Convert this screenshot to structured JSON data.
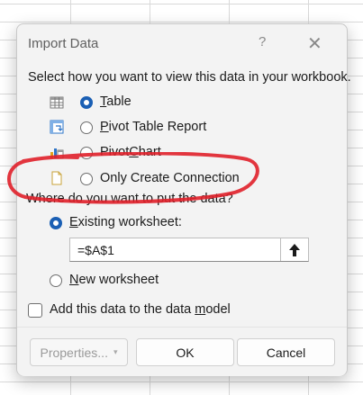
{
  "dialog": {
    "title": "Import Data",
    "help_glyph": "?",
    "close_glyph": "✕"
  },
  "view_section": {
    "prompt": "Select how you want to view this data in your workbook.",
    "options": [
      {
        "label_first": "T",
        "label_rest": "able",
        "selected": true,
        "icon": "table-icon"
      },
      {
        "label_first": "P",
        "label_rest": "ivot Table Report",
        "selected": false,
        "icon": "pivot-table-icon"
      },
      {
        "label_before": "Pivot",
        "label_u": "C",
        "label_rest": "hart",
        "selected": false,
        "icon": "pivot-chart-icon"
      },
      {
        "label": "Only Create Connection",
        "selected": false,
        "icon": "connection-icon"
      }
    ]
  },
  "destination_section": {
    "prompt": "Where do you want to put the data?",
    "existing_label_first": "E",
    "existing_label_rest": "xisting worksheet:",
    "existing_selected": true,
    "cell_ref": "=$A$1",
    "collapse_glyph": "🡑",
    "new_label_first": "N",
    "new_label_rest": "ew worksheet",
    "new_selected": false
  },
  "data_model": {
    "label_before": "Add this data to the data ",
    "label_u": "m",
    "label_rest": "odel",
    "checked": false
  },
  "buttons": {
    "properties": "Properties...",
    "properties_arrow": "▾",
    "ok": "OK",
    "cancel": "Cancel"
  },
  "colors": {
    "accent": "#1a5fb4",
    "annotation": "#e0202a"
  }
}
